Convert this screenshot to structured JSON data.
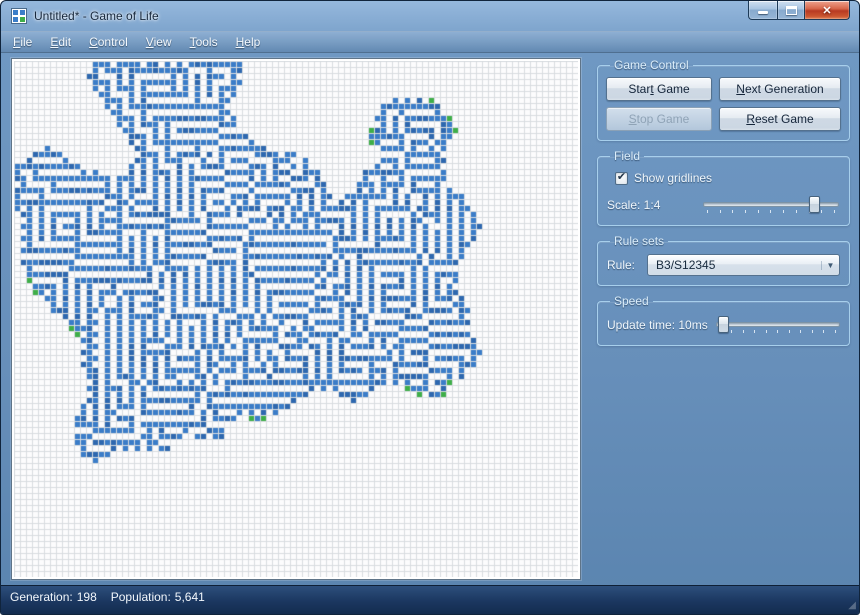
{
  "window": {
    "title": "Untitled* - Game of Life"
  },
  "icons": {
    "close": "✕",
    "check": "✔",
    "combo_arrow": "▼",
    "grip": "◢"
  },
  "menu": {
    "items": [
      {
        "pre": "",
        "key": "F",
        "post": "ile"
      },
      {
        "pre": "",
        "key": "E",
        "post": "dit"
      },
      {
        "pre": "",
        "key": "C",
        "post": "ontrol"
      },
      {
        "pre": "",
        "key": "V",
        "post": "iew"
      },
      {
        "pre": "",
        "key": "T",
        "post": "ools"
      },
      {
        "pre": "",
        "key": "H",
        "post": "elp"
      }
    ]
  },
  "panels": {
    "game_control": {
      "title": "Game Control",
      "buttons": [
        {
          "pre": "Star",
          "key": "t",
          "post": " Game",
          "enabled": true
        },
        {
          "pre": "",
          "key": "N",
          "post": "ext Generation",
          "enabled": true
        },
        {
          "pre": "",
          "key": "S",
          "post": "top Game",
          "enabled": false
        },
        {
          "pre": "",
          "key": "R",
          "post": "eset Game",
          "enabled": true
        }
      ]
    },
    "field": {
      "title": "Field",
      "checkbox_label": "Show gridlines",
      "checkbox_checked": true,
      "scale_label": "Scale: 1:4",
      "scale_slider": {
        "value_percent": 82,
        "ticks": 11
      }
    },
    "rule_sets": {
      "title": "Rule sets",
      "rule_label": "Rule:",
      "rule_value": "B3/S12345"
    },
    "speed": {
      "title": "Speed",
      "label": "Update time: 10ms",
      "slider": {
        "value_percent": 7,
        "ticks": 11
      }
    }
  },
  "status": {
    "generation_label": "Generation:",
    "generation_value": "198",
    "population_label": "Population:",
    "population_value": "5,641"
  },
  "grid": {
    "rule": "B3/S12345",
    "generations": 198,
    "cols": 94,
    "rows": 86,
    "cell_size": 6,
    "seed": 7,
    "background": "#fcfcfd",
    "gridline_color": "#d8dce0",
    "cell_color": "#3b7dc8",
    "cell_color_dark": "#2e68af",
    "new_cell_color": "#3fae49"
  },
  "colors": {
    "groupbox_border": "#a7cfec",
    "status_bg": "#1b3760",
    "frame_top": "#95b8dd",
    "frame_bottom": "#5a84af"
  }
}
